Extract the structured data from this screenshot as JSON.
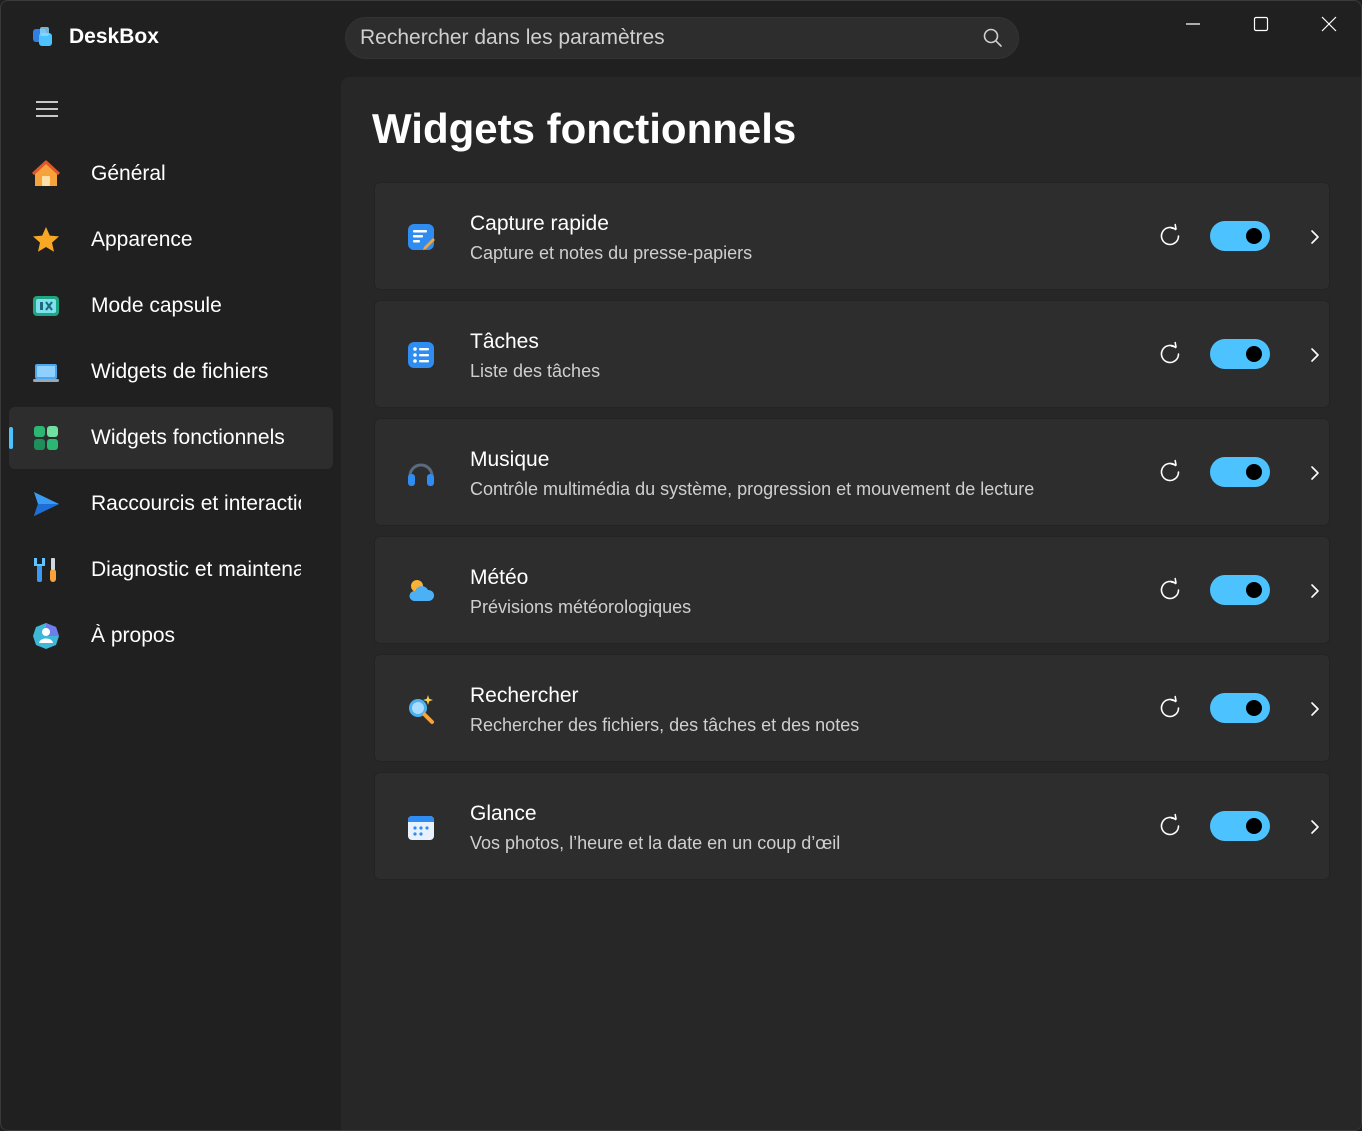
{
  "app": {
    "name": "DeskBox"
  },
  "search": {
    "placeholder": "Rechercher dans les paramètres"
  },
  "colors": {
    "accent": "#4cc2ff",
    "background": "#202020",
    "content": "#272727",
    "card": "#2d2d2d"
  },
  "sidebar": {
    "items": [
      {
        "label": "Général",
        "icon": "home-icon",
        "active": false
      },
      {
        "label": "Apparence",
        "icon": "star-icon",
        "active": false
      },
      {
        "label": "Mode capsule",
        "icon": "capsule-icon",
        "active": false
      },
      {
        "label": "Widgets de fichiers",
        "icon": "laptop-icon",
        "active": false
      },
      {
        "label": "Widgets fonctionnels",
        "icon": "widgets-icon",
        "active": true
      },
      {
        "label": "Raccourcis et interactions",
        "icon": "send-icon",
        "active": false
      },
      {
        "label": "Diagnostic et maintenance",
        "icon": "tools-icon",
        "active": false
      },
      {
        "label": "À propos",
        "icon": "about-icon",
        "active": false
      }
    ]
  },
  "page": {
    "title": "Widgets fonctionnels"
  },
  "widgets": [
    {
      "title": "Capture rapide",
      "description": "Capture et notes du presse-papiers",
      "icon": "quick-capture-icon",
      "enabled": true
    },
    {
      "title": "Tâches",
      "description": "Liste des tâches",
      "icon": "tasks-icon",
      "enabled": true
    },
    {
      "title": "Musique",
      "description": "Contrôle multimédia du système, progression et mouvement de lecture",
      "icon": "headphones-icon",
      "enabled": true
    },
    {
      "title": "Météo",
      "description": "Prévisions météorologiques",
      "icon": "weather-icon",
      "enabled": true
    },
    {
      "title": "Rechercher",
      "description": "Rechercher des fichiers, des tâches et des notes",
      "icon": "search-widget-icon",
      "enabled": true
    },
    {
      "title": "Glance",
      "description": "Vos photos, l’heure et la date en un coup d’œil",
      "icon": "calendar-icon",
      "enabled": true
    }
  ]
}
